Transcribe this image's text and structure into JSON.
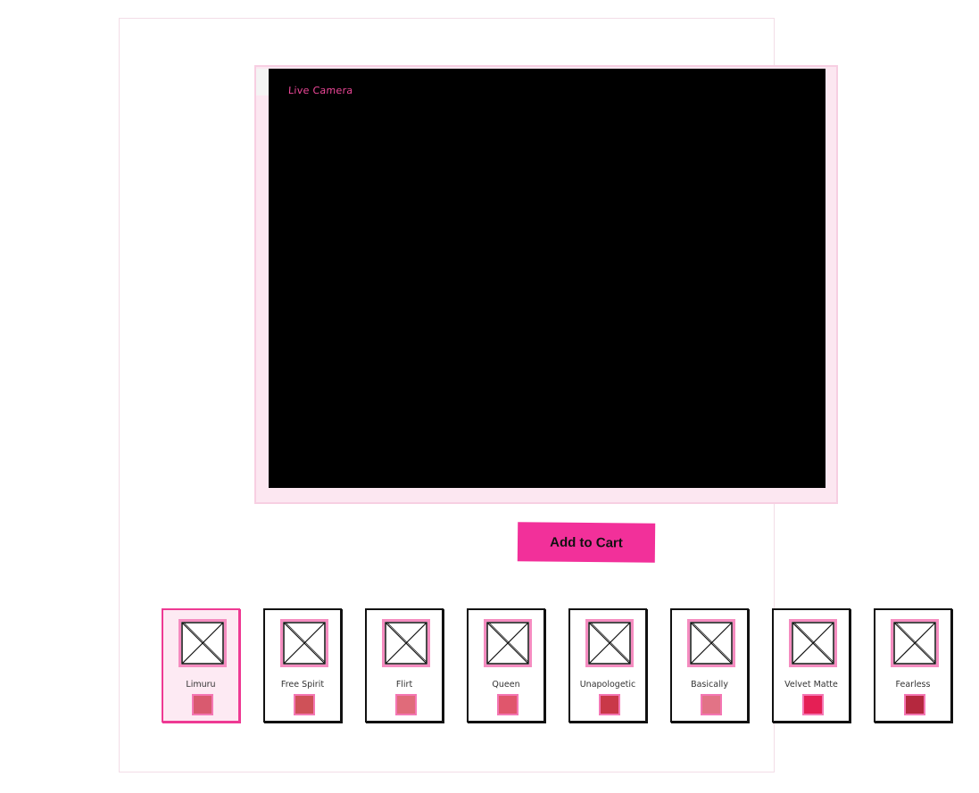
{
  "camera": {
    "label": "Live Camera"
  },
  "actions": {
    "add_to_cart": "Add to Cart"
  },
  "colors": {
    "accent": "#f2309a",
    "panel_bg": "#fce7f1",
    "camera_bg": "#000000"
  },
  "shades": [
    {
      "name": "Limuru",
      "color": "#d95a6f",
      "selected": true
    },
    {
      "name": "Free Spirit",
      "color": "#cf5158",
      "selected": false
    },
    {
      "name": "Flirt",
      "color": "#e06b7a",
      "selected": false
    },
    {
      "name": "Queen",
      "color": "#e0566c",
      "selected": false
    },
    {
      "name": "Unapologetic",
      "color": "#c93848",
      "selected": false
    },
    {
      "name": "Basically",
      "color": "#e27386",
      "selected": false
    },
    {
      "name": "Velvet Matte",
      "color": "#e51f55",
      "selected": false
    },
    {
      "name": "Fearless",
      "color": "#b5283e",
      "selected": false
    }
  ]
}
